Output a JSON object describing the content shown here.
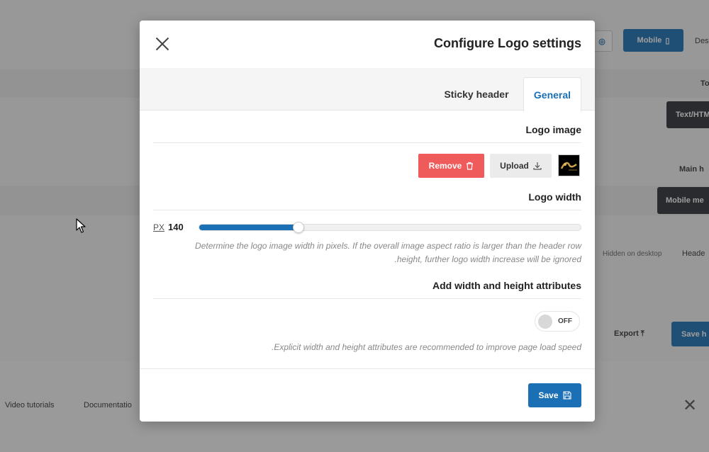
{
  "background": {
    "toolbar": {
      "mobile_label": "Mobile",
      "desktop_label": "Des"
    },
    "right_labels": {
      "top": "To",
      "text_html": "Text/HTM",
      "main_header": "Main h",
      "mobile_menu": "Mobile me",
      "hidden_desktop": "Hidden on desktop",
      "header": "Heade",
      "export": "Export",
      "save_header": "Save h"
    },
    "footer": {
      "video_tutorials": "Video tutorials",
      "documentation": "Documentatio"
    }
  },
  "modal": {
    "title": "Configure Logo settings",
    "tabs": [
      {
        "label": "Sticky header",
        "active": false
      },
      {
        "label": "General",
        "active": true
      }
    ],
    "logo_image": {
      "title": "Logo image",
      "remove_label": "Remove",
      "upload_label": "Upload"
    },
    "logo_width": {
      "title": "Logo width",
      "unit": "PX",
      "value": "140",
      "slider_fraction": 0.26,
      "help_line1": "Determine the logo image width in pixels. If the overall image aspect ratio is larger than the header row",
      "help_line2": ".height, further logo width increase will be ignored"
    },
    "attributes": {
      "title": "Add width and height attributes",
      "toggle_label": "OFF",
      "toggle_on": false,
      "help": ".Explicit width and height attributes are recommended to improve page load speed"
    },
    "save_label": "Save"
  },
  "colors": {
    "accent": "#1a6fb5",
    "danger": "#ef5a5a",
    "dark_button": "#2b2f33"
  }
}
